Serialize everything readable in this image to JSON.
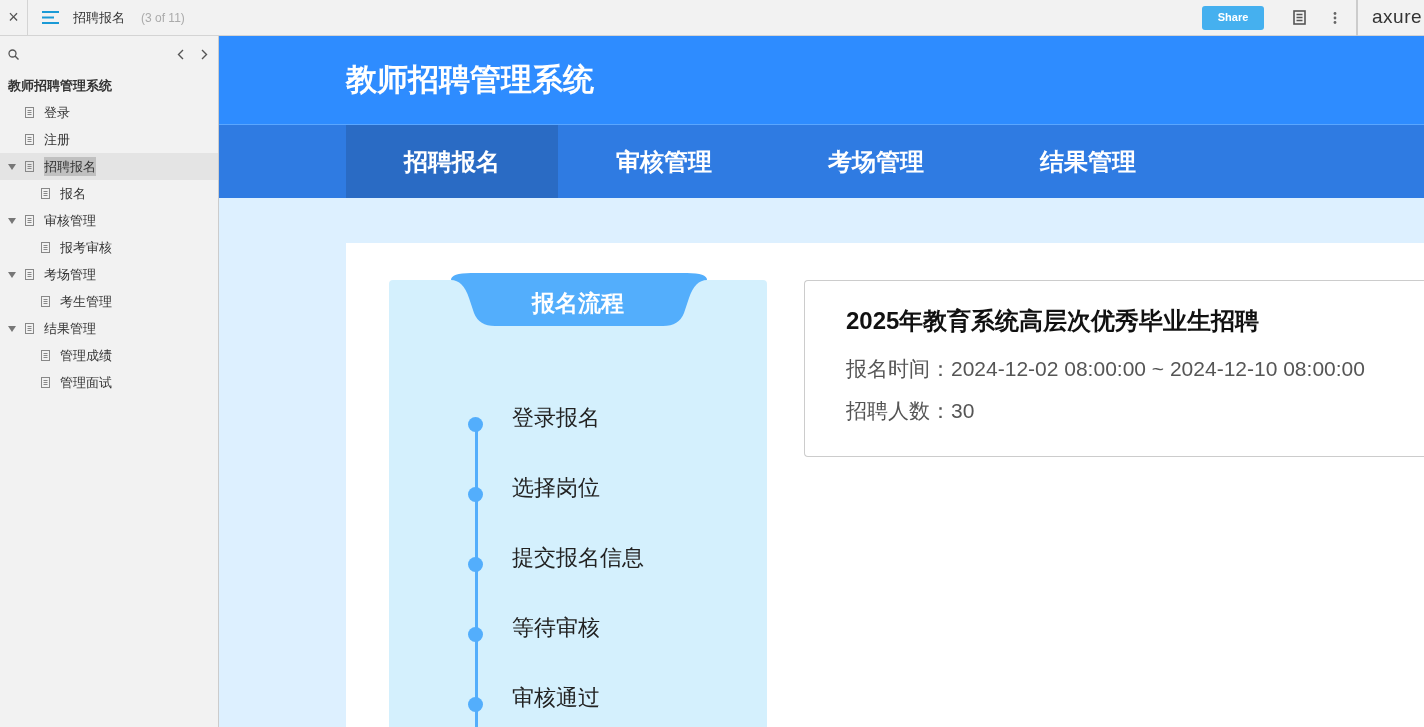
{
  "toolbar": {
    "close": "×",
    "page_title": "招聘报名",
    "page_count": "(3 of 11)",
    "share": "Share",
    "brand": "axure"
  },
  "sidebar": {
    "project": "教师招聘管理系统",
    "items": [
      {
        "label": "登录",
        "selected": false
      },
      {
        "label": "注册",
        "selected": false
      },
      {
        "label": "招聘报名",
        "selected": true,
        "expanded": true,
        "children": [
          {
            "label": "报名",
            "selected": false
          }
        ]
      },
      {
        "label": "审核管理",
        "selected": false,
        "expanded": true,
        "children": [
          {
            "label": "报考审核",
            "selected": false
          }
        ]
      },
      {
        "label": "考场管理",
        "selected": false,
        "expanded": true,
        "children": [
          {
            "label": "考生管理",
            "selected": false
          }
        ]
      },
      {
        "label": "结果管理",
        "selected": false,
        "expanded": true,
        "children": [
          {
            "label": "管理成绩",
            "selected": false
          },
          {
            "label": "管理面试",
            "selected": false
          }
        ]
      }
    ]
  },
  "header": {
    "title": "教师招聘管理系统"
  },
  "nav": [
    {
      "label": "招聘报名",
      "selected": true
    },
    {
      "label": "审核管理",
      "selected": false
    },
    {
      "label": "考场管理",
      "selected": false
    },
    {
      "label": "结果管理",
      "selected": false
    }
  ],
  "process": {
    "title": "报名流程",
    "steps": [
      "登录报名",
      "选择岗位",
      "提交报名信息",
      "等待审核",
      "审核通过"
    ]
  },
  "recruitment": {
    "title": "2025年教育系统高层次优秀毕业生招聘",
    "fields": [
      {
        "label": "报名时间：",
        "value": "2024-12-02 08:00:00 ~ 2024-12-10 08:00:00"
      },
      {
        "label": "招聘人数：",
        "value": "30"
      }
    ]
  }
}
